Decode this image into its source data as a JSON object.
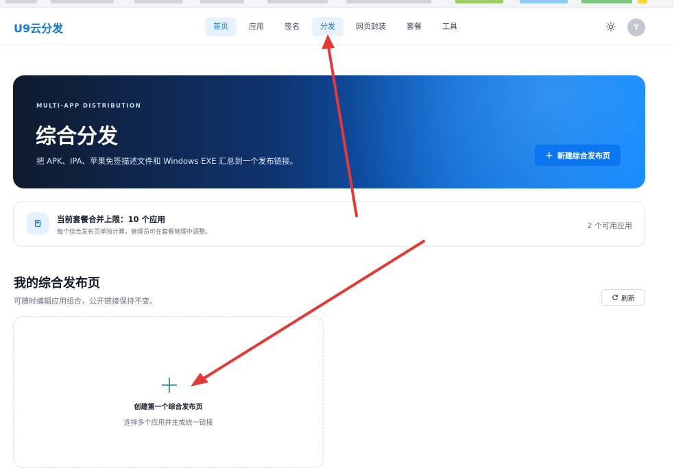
{
  "header": {
    "logo": "U9云分发",
    "nav": [
      {
        "label": "首页",
        "active": true
      },
      {
        "label": "应用",
        "active": false
      },
      {
        "label": "签名",
        "active": false
      },
      {
        "label": "分发",
        "active": true
      },
      {
        "label": "网页封装",
        "active": false
      },
      {
        "label": "套餐",
        "active": false
      },
      {
        "label": "工具",
        "active": false
      }
    ],
    "avatar_initial": "Y",
    "theme_icon": "sun-icon"
  },
  "hero": {
    "eyebrow": "MULTI-APP DISTRIBUTION",
    "title": "综合分发",
    "description": "把 APK、IPA、苹果免签描述文件和 Windows EXE 汇总到一个发布链接。",
    "button_label": "新建综合发布页"
  },
  "plan": {
    "title": "当前套餐合并上限：10 个应用",
    "subtitle": "每个综合发布页单独计算，管理员可在套餐管理中调整。",
    "available": "2 个可用应用"
  },
  "section": {
    "title": "我的综合发布页",
    "subtitle": "可随时编辑应用组合，公开链接保持不变。",
    "refresh_label": "刷新"
  },
  "empty": {
    "title": "创建第一个综合发布页",
    "subtitle": "选择多个应用并生成统一链接"
  },
  "colors": {
    "brand": "#1677d4",
    "annotation": "#e53935"
  }
}
